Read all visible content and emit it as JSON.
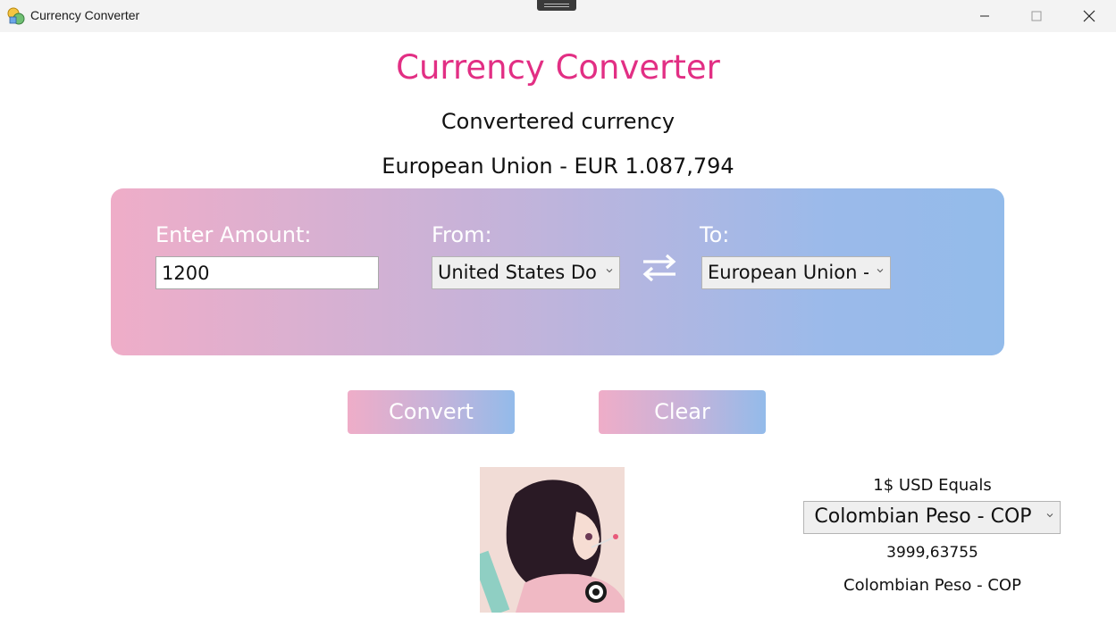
{
  "window": {
    "title": "Currency Converter",
    "icon": "currency-app-icon"
  },
  "header": {
    "title": "Currency Converter",
    "subtitle": "Convertered currency",
    "result": "European Union - EUR 1.087,794"
  },
  "form": {
    "amount_label": "Enter Amount:",
    "amount_value": "1200",
    "from_label": "From:",
    "from_selected": "United States Doll",
    "to_label": "To:",
    "to_selected": "European Union -",
    "swap_icon": "swap-arrows-icon"
  },
  "actions": {
    "convert_label": "Convert",
    "clear_label": "Clear"
  },
  "rate": {
    "caption": "1$ USD Equals",
    "selected": "Colombian Peso - COP",
    "value": "3999,63755",
    "name": "Colombian Peso - COP"
  },
  "colors": {
    "title": "#e22f84",
    "gradient_start": "#efadc8",
    "gradient_end": "#93bbea"
  }
}
